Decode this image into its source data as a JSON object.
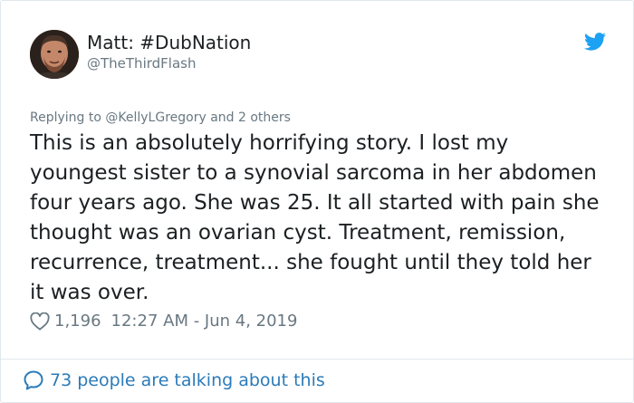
{
  "tweet": {
    "author": {
      "display_name": "Matt: #DubNation",
      "handle": "@TheThirdFlash"
    },
    "reply_context": {
      "prefix": "Replying to ",
      "mention": "@KellyLGregory",
      "suffix": " and 2 others"
    },
    "text": "This is an absolutely horrifying story. I lost my youngest sister to a synovial sarcoma in her abdomen four years ago. She was 25. It all started with pain she thought was an ovarian cyst. Treatment, remission, recurrence, treatment... she fought until they told her it was over.",
    "likes": "1,196",
    "timestamp": "12:27 AM - Jun 4, 2019",
    "conversation_link": "73 people are talking about this"
  },
  "icons": {
    "brand": "twitter-bird-icon",
    "like": "heart-outline-icon",
    "conversation": "speech-bubble-icon"
  },
  "colors": {
    "brand_blue": "#1da1f2",
    "link_blue": "#2b7bb9",
    "secondary_text": "#697882",
    "primary_text": "#1c2022",
    "border": "#e1e8ed"
  }
}
